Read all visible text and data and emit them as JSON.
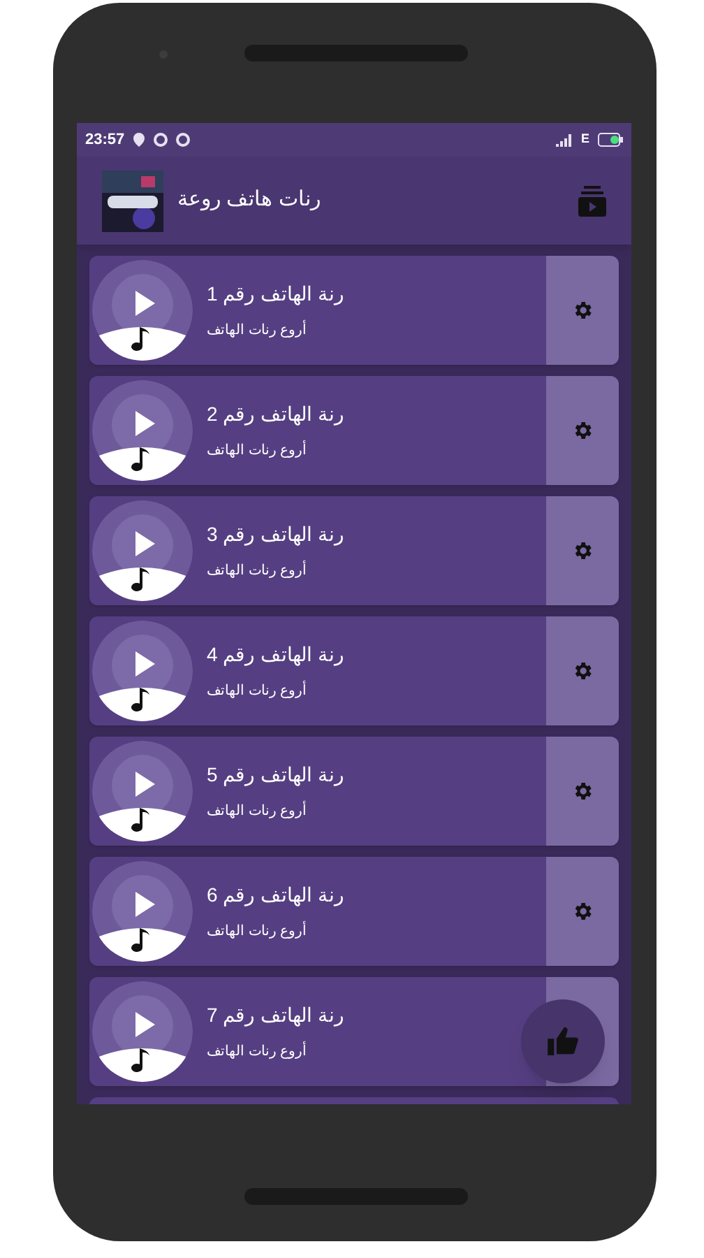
{
  "status_bar": {
    "time": "23:57",
    "network": "E"
  },
  "header": {
    "title": "رنات هاتف روعة"
  },
  "rows": [
    {
      "title": "رنة الهاتف رقم 1",
      "subtitle": "أروع رنات الهاتف",
      "settings_icon": true
    },
    {
      "title": "رنة الهاتف رقم 2",
      "subtitle": "أروع رنات الهاتف",
      "settings_icon": true
    },
    {
      "title": "رنة الهاتف رقم 3",
      "subtitle": "أروع رنات الهاتف",
      "settings_icon": true
    },
    {
      "title": "رنة الهاتف رقم 4",
      "subtitle": "أروع رنات الهاتف",
      "settings_icon": true
    },
    {
      "title": "رنة الهاتف رقم 5",
      "subtitle": "أروع رنات الهاتف",
      "settings_icon": true
    },
    {
      "title": "رنة الهاتف رقم 6",
      "subtitle": "أروع رنات الهاتف",
      "settings_icon": true
    },
    {
      "title": "رنة الهاتف رقم 7",
      "subtitle": "أروع رنات الهاتف",
      "settings_icon": false
    }
  ]
}
